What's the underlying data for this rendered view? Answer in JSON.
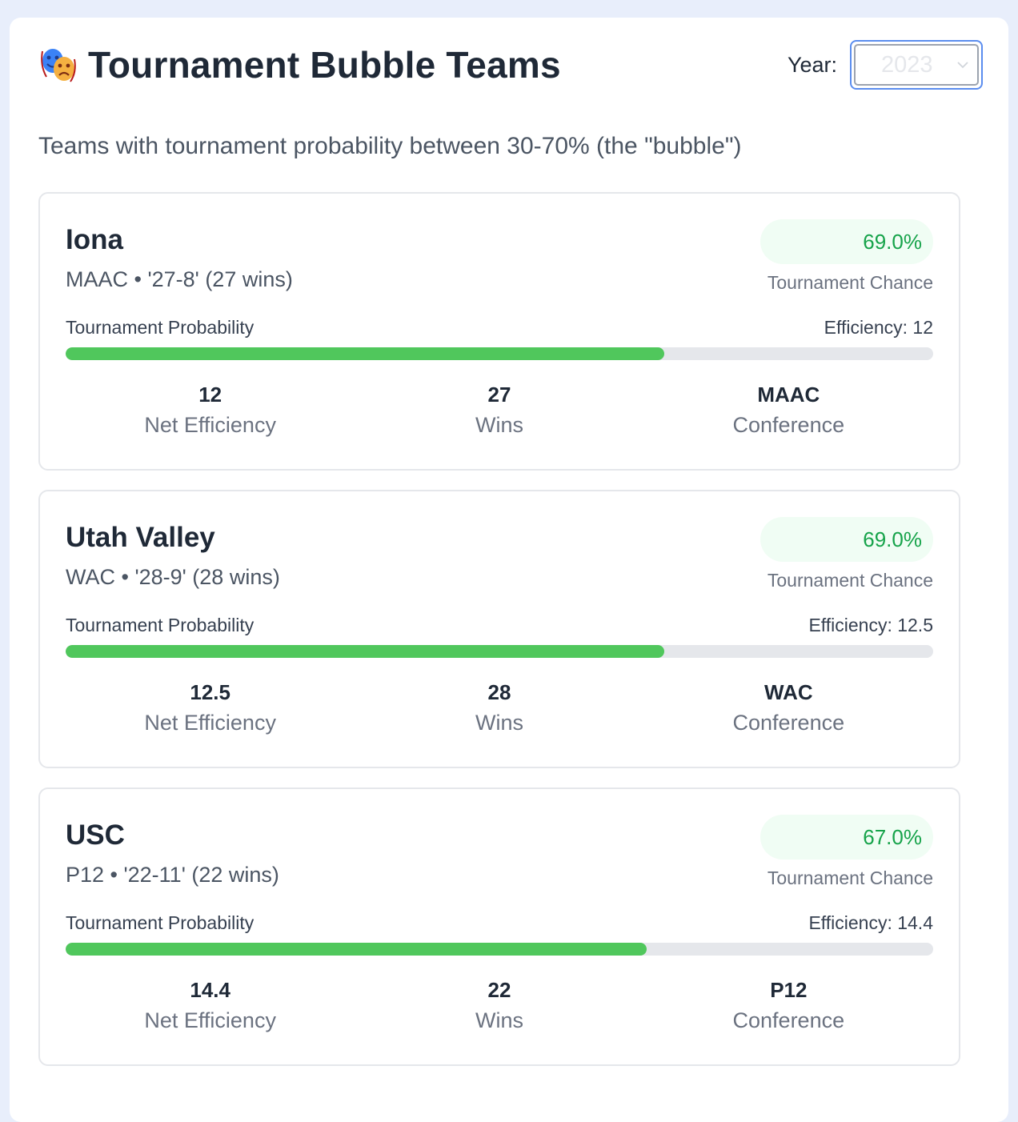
{
  "header": {
    "title": "Tournament Bubble Teams",
    "icon": "theater-masks-icon",
    "year_label": "Year:",
    "year_value": "2023"
  },
  "subtitle": "Teams with tournament probability between 30-70% (the \"bubble\")",
  "colors": {
    "accent_green": "#50c75c",
    "chance_text": "#16a34a",
    "select_border": "#5b8def"
  },
  "teams": [
    {
      "name": "Iona",
      "meta": "MAAC • '27-8' (27 wins)",
      "chance": "69.0%",
      "chance_label": "Tournament Chance",
      "prob_label": "Tournament Probability",
      "efficiency_text": "Efficiency: 12",
      "probability": 0.69,
      "stats": [
        {
          "value": "12",
          "label": "Net Efficiency"
        },
        {
          "value": "27",
          "label": "Wins"
        },
        {
          "value": "MAAC",
          "label": "Conference"
        }
      ]
    },
    {
      "name": "Utah Valley",
      "meta": "WAC • '28-9' (28 wins)",
      "chance": "69.0%",
      "chance_label": "Tournament Chance",
      "prob_label": "Tournament Probability",
      "efficiency_text": "Efficiency: 12.5",
      "probability": 0.69,
      "stats": [
        {
          "value": "12.5",
          "label": "Net Efficiency"
        },
        {
          "value": "28",
          "label": "Wins"
        },
        {
          "value": "WAC",
          "label": "Conference"
        }
      ]
    },
    {
      "name": "USC",
      "meta": "P12 • '22-11' (22 wins)",
      "chance": "67.0%",
      "chance_label": "Tournament Chance",
      "prob_label": "Tournament Probability",
      "efficiency_text": "Efficiency: 14.4",
      "probability": 0.67,
      "stats": [
        {
          "value": "14.4",
          "label": "Net Efficiency"
        },
        {
          "value": "22",
          "label": "Wins"
        },
        {
          "value": "P12",
          "label": "Conference"
        }
      ]
    }
  ]
}
